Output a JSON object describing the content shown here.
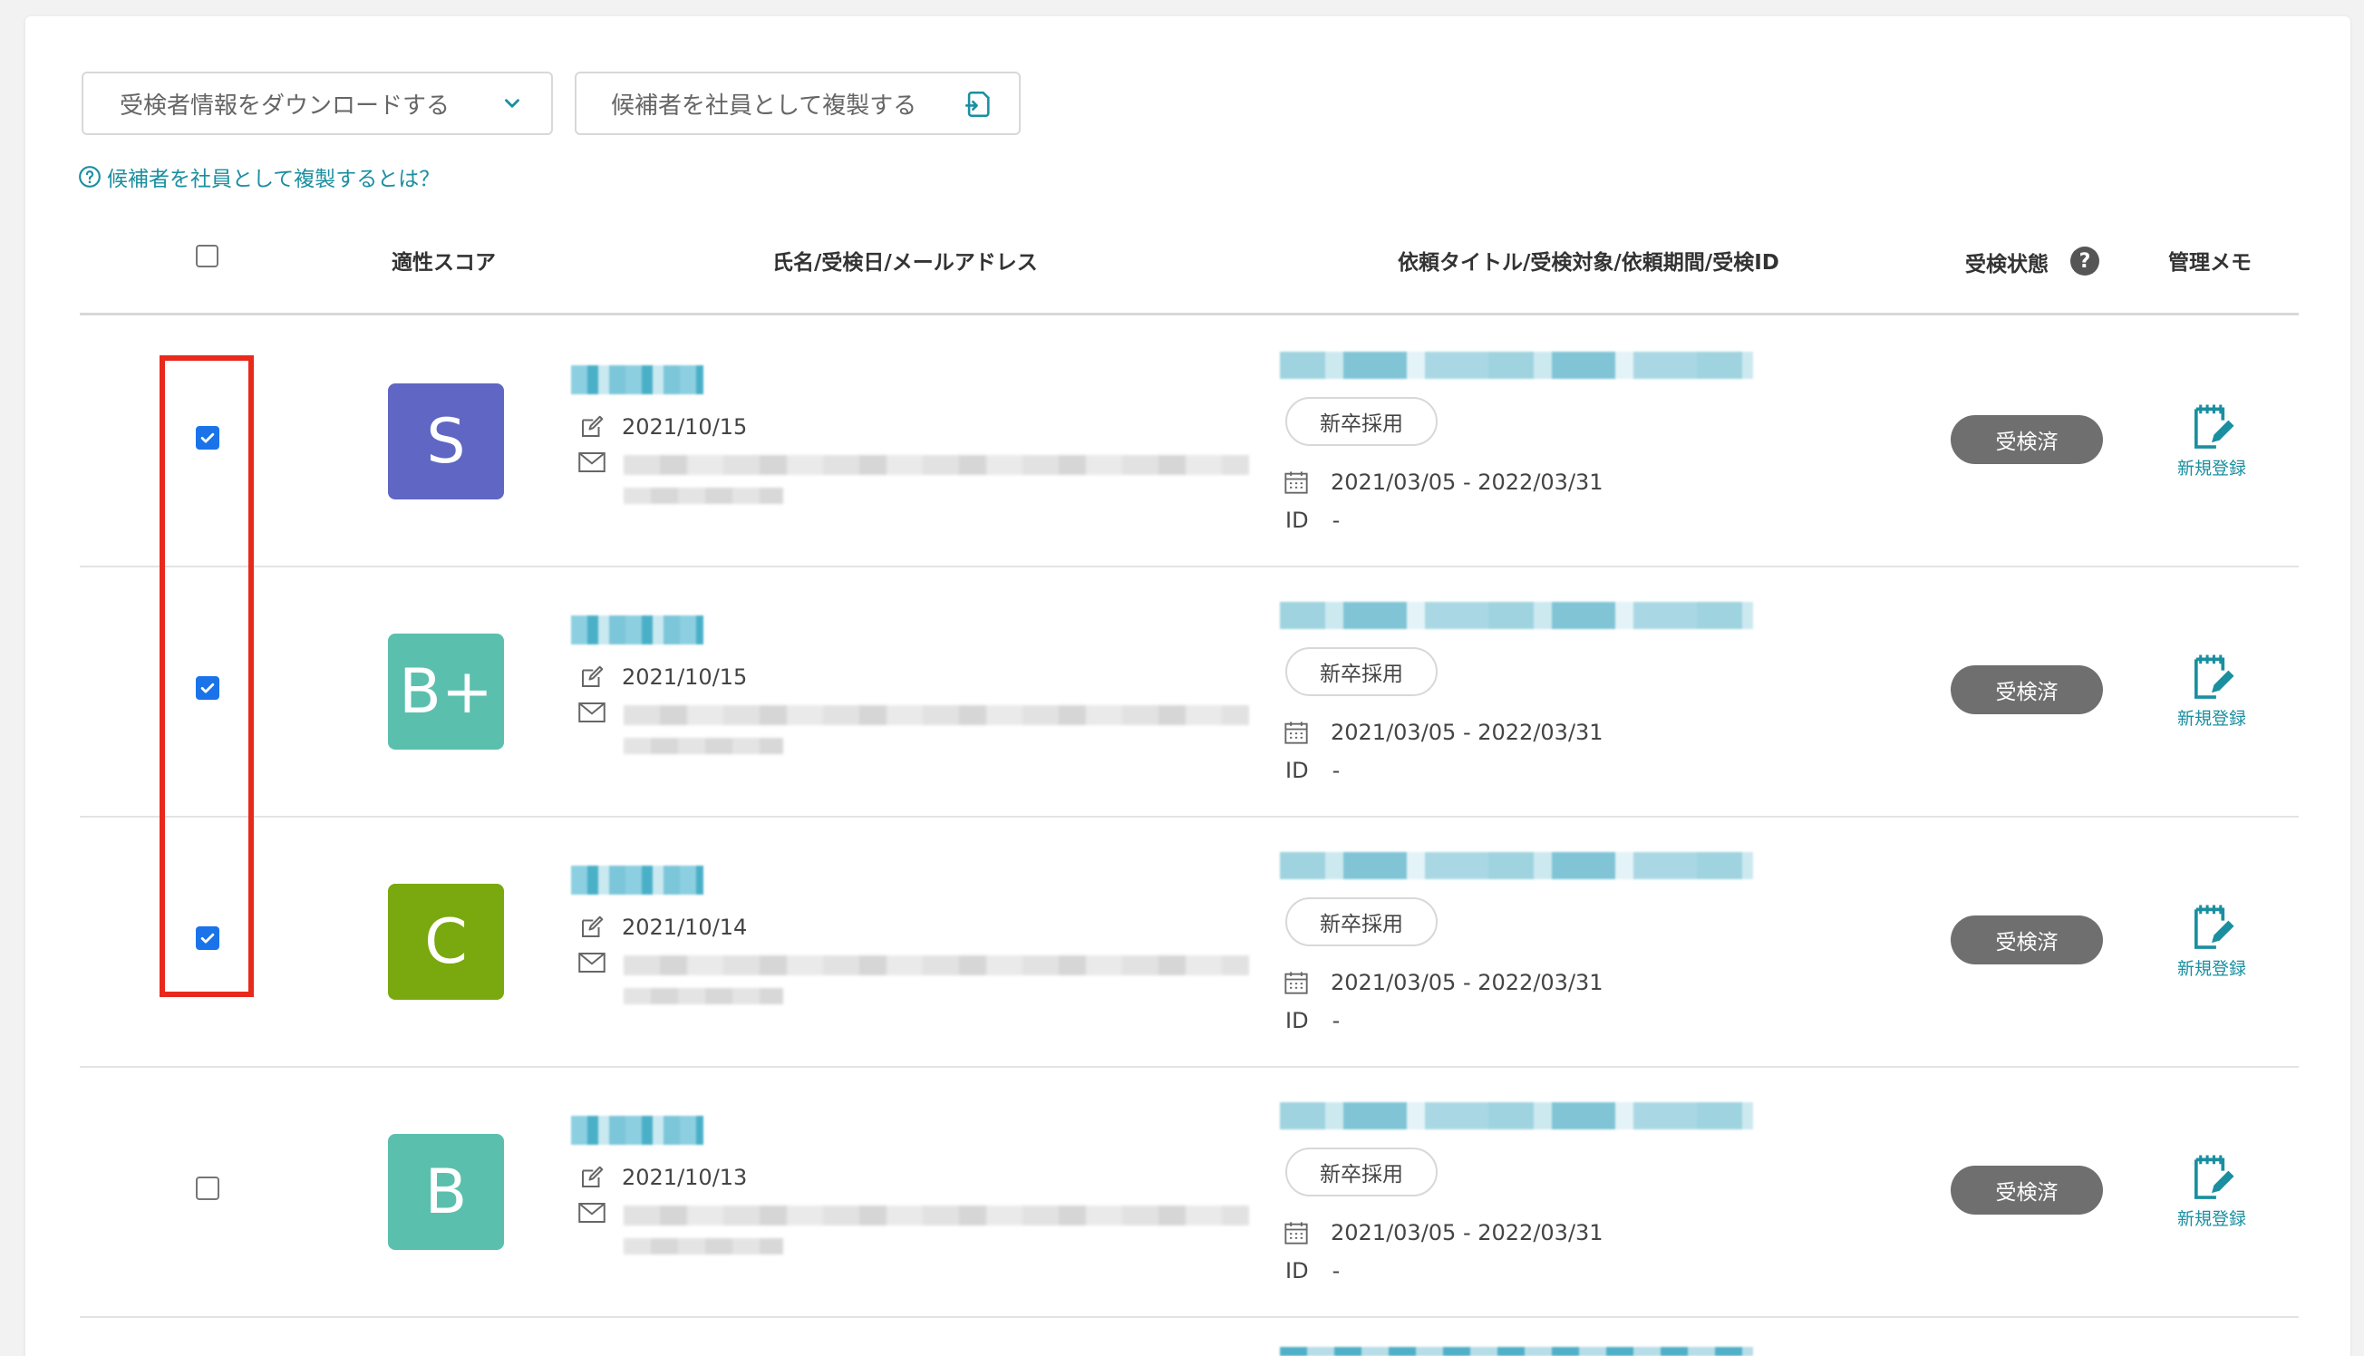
{
  "toolbar": {
    "download_label": "受検者情報をダウンロードする",
    "duplicate_label": "候補者を社員として複製する",
    "help_link": "候補者を社員として複製するとは？"
  },
  "table": {
    "headers": {
      "score": "適性スコア",
      "name": "氏名/受検日/メールアドレス",
      "request": "依頼タイトル/受検対象/依頼期間/受検ID",
      "status": "受検状態",
      "memo": "管理メモ"
    },
    "status_help": "?",
    "rows": [
      {
        "checked": true,
        "score": "S",
        "score_color": "#5f66c3",
        "date": "2021/10/15",
        "tag": "新卒採用",
        "period": "2021/03/05 - 2022/03/31",
        "id_label": "ID",
        "id_value": "-",
        "status": "受検済",
        "memo": "新規登録"
      },
      {
        "checked": true,
        "score": "B+",
        "score_color": "#5bbfae",
        "date": "2021/10/15",
        "tag": "新卒採用",
        "period": "2021/03/05 - 2022/03/31",
        "id_label": "ID",
        "id_value": "-",
        "status": "受検済",
        "memo": "新規登録"
      },
      {
        "checked": true,
        "score": "C",
        "score_color": "#7aa80f",
        "date": "2021/10/14",
        "tag": "新卒採用",
        "period": "2021/03/05 - 2022/03/31",
        "id_label": "ID",
        "id_value": "-",
        "status": "受検済",
        "memo": "新規登録"
      },
      {
        "checked": false,
        "score": "B",
        "score_color": "#5bbfae",
        "date": "2021/10/13",
        "tag": "新卒採用",
        "period": "2021/03/05 - 2022/03/31",
        "id_label": "ID",
        "id_value": "-",
        "status": "受検済",
        "memo": "新規登録"
      }
    ]
  },
  "colors": {
    "accent": "#1a8fa0",
    "checkbox": "#1a73e8",
    "highlight": "#e8291c",
    "status_badge": "#6f6f6f"
  }
}
